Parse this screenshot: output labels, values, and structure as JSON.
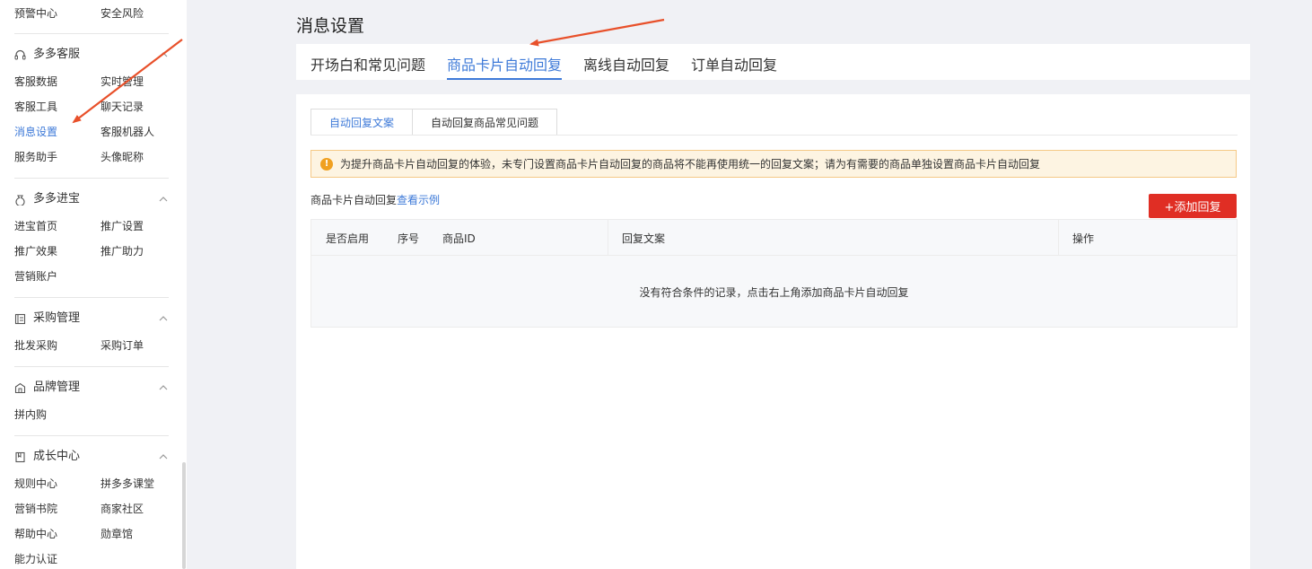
{
  "sidebar": {
    "top_row": [
      "预警中心",
      "安全风险"
    ],
    "groups": [
      {
        "title": "多多客服",
        "icon": "headset-icon",
        "items": [
          "客服数据",
          "实时管理",
          "客服工具",
          "聊天记录",
          "消息设置",
          "客服机器人",
          "服务助手",
          "头像昵称"
        ],
        "active": "消息设置"
      },
      {
        "title": "多多进宝",
        "icon": "money-bag-icon",
        "items": [
          "进宝首页",
          "推广设置",
          "推广效果",
          "推广助力",
          "营销账户"
        ]
      },
      {
        "title": "采购管理",
        "icon": "purchase-icon",
        "items": [
          "批发采购",
          "采购订单"
        ]
      },
      {
        "title": "品牌管理",
        "icon": "shop-icon",
        "items": [
          "拼内购"
        ]
      },
      {
        "title": "成长中心",
        "icon": "book-icon",
        "items": [
          "规则中心",
          "拼多多课堂",
          "营销书院",
          "商家社区",
          "帮助中心",
          "勋章馆",
          "能力认证"
        ]
      }
    ]
  },
  "page": {
    "title": "消息设置"
  },
  "tabs": [
    "开场白和常见问题",
    "商品卡片自动回复",
    "离线自动回复",
    "订单自动回复"
  ],
  "active_tab": "商品卡片自动回复",
  "subtabs": [
    "自动回复文案",
    "自动回复商品常见问题"
  ],
  "notice": "为提升商品卡片自动回复的体验，未专门设置商品卡片自动回复的商品将不能再使用统一的回复文案；请为有需要的商品单独设置商品卡片自动回复",
  "hint": {
    "text": "商品卡片自动回复",
    "link": "查看示例"
  },
  "add_button": "+添加回复",
  "table": {
    "headers": [
      "是否启用",
      "序号",
      "商品ID",
      "回复文案",
      "操作"
    ],
    "empty": "没有符合条件的记录，点击右上角添加商品卡片自动回复"
  },
  "colors": {
    "accent": "#3e7ad8",
    "danger": "#e02e24",
    "arrow": "#e8502a"
  }
}
